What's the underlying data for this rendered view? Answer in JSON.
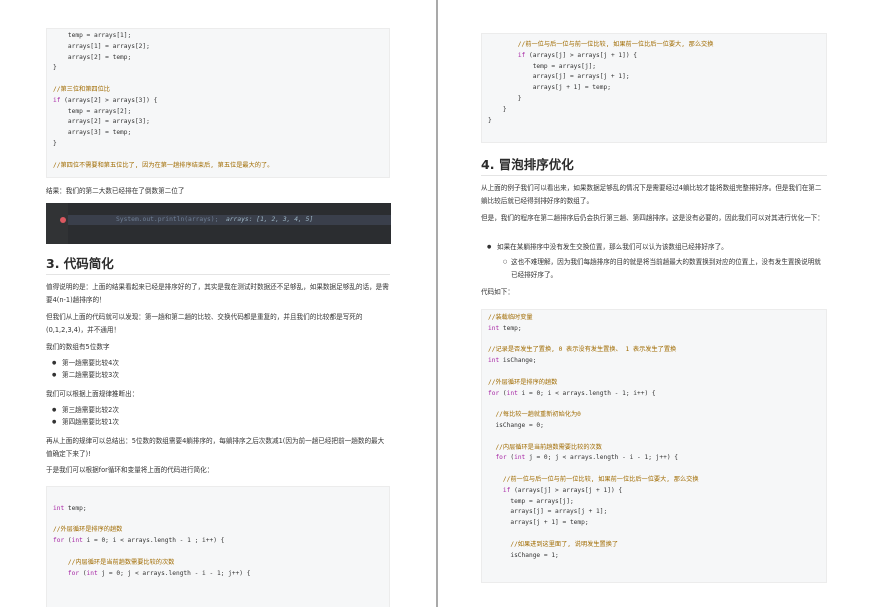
{
  "left": {
    "code1": [
      "    temp = arrays[1];",
      "    arrays[1] = arrays[2];",
      "    arrays[2] = temp;",
      "}",
      "",
      "//第三位和第四位比",
      "if (arrays[2] > arrays[3]) {",
      "    temp = arrays[2];",
      "    arrays[2] = arrays[3];",
      "    arrays[3] = temp;",
      "}",
      "",
      "//第四位不需要和第五位比了, 因为在第一趟排序结束后, 第五位是最大的了。"
    ],
    "result_text": "结果：我们的第二大数已经排在了倒数第二位了",
    "ide_line": "System.out.println(arrays);",
    "ide_hint": "arrays: [1, 2, 3, 4, 5]",
    "section3_title": "3. 代码简化",
    "p1": "值得说明的是：上面的结果看起来已经是排序好的了，其实是我在测试时数据还不足够乱，如果数据足够乱的话，是需要4(n-1)趟排序的！",
    "p2": "但我们从上面的代码就可以发现：第一趟和第二趟的比较、交换代码都是重复的，并且我们的比较都是写死的(0,1,2,3,4)，并不通用！",
    "p3": "我们的数组有5位数字",
    "list1": [
      "第一趟需要比较4次",
      "第二趟需要比较3次"
    ],
    "p4": "我们可以根据上面规律推断出：",
    "list2": [
      "第三趟需要比较2次",
      "第四趟需要比较1次"
    ],
    "p5": "再从上面的规律可以总结出：5位数的数组需要4躺排序的，每躺排序之后次数减1(因为前一趟已经把前一趟数的最大值确定下来了)!",
    "p6": "于是我们可以根据for循环和变量将上面的代码进行简化：",
    "code2": [
      "",
      "int temp;",
      "",
      "//外层循环是排序的趟数",
      "for (int i = 0; i < arrays.length - 1 ; i++) {",
      "",
      "    //内层循环是当前趟数需要比较的次数",
      "    for (int j = 0; j < arrays.length - i - 1; j++) {"
    ]
  },
  "right": {
    "code1": [
      "        //前一位与后一位与前一位比较, 如果前一位比后一位要大, 那么交换",
      "        if (arrays[j] > arrays[j + 1]) {",
      "            temp = arrays[j];",
      "            arrays[j] = arrays[j + 1];",
      "            arrays[j + 1] = temp;",
      "        }",
      "    }",
      "}"
    ],
    "section4_title": "4. 冒泡排序优化",
    "p1": "从上面的例子我们可以看出来，如果数据足够乱的情况下是需要经过4躺比较才能将数组完整排好序。但是我们在第二躺比较后就已经得到排好序的数组了。",
    "p2": "但是，我们的程序在第二趟排序后仍会执行第三趟、第四趟排序。这是没有必要的，因此我们可以对其进行优化一下：",
    "bullet": "如果在某躺排序中没有发生交换位置，那么我们可以认为该数组已经排好序了。",
    "subbullet": "这也不难理解，因为我们每趟排序的目的就是将当前趟最大的数置换到对应的位置上，没有发生置换说明就已经排好序了。",
    "p3": "代码如下：",
    "code2": [
      "//装载临时变量",
      "int temp;",
      "",
      "//记录是否发生了置换, 0 表示没有发生置换、 1 表示发生了置换",
      "int isChange;",
      "",
      "//外层循环是排序的趟数",
      "for (int i = 0; i < arrays.length - 1; i++) {",
      "",
      "  //每比较一趟就重新初始化为0",
      "  isChange = 0;",
      "",
      "  //内层循环是当前趟数需要比较的次数",
      "  for (int j = 0; j < arrays.length - i - 1; j++) {",
      "",
      "    //前一位与后一位与前一位比较, 如果前一位比后一位要大, 那么交换",
      "    if (arrays[j] > arrays[j + 1]) {",
      "      temp = arrays[j];",
      "      arrays[j] = arrays[j + 1];",
      "      arrays[j + 1] = temp;",
      "",
      "      //如果进到这里面了, 说明发生置换了",
      "      isChange = 1;"
    ]
  }
}
